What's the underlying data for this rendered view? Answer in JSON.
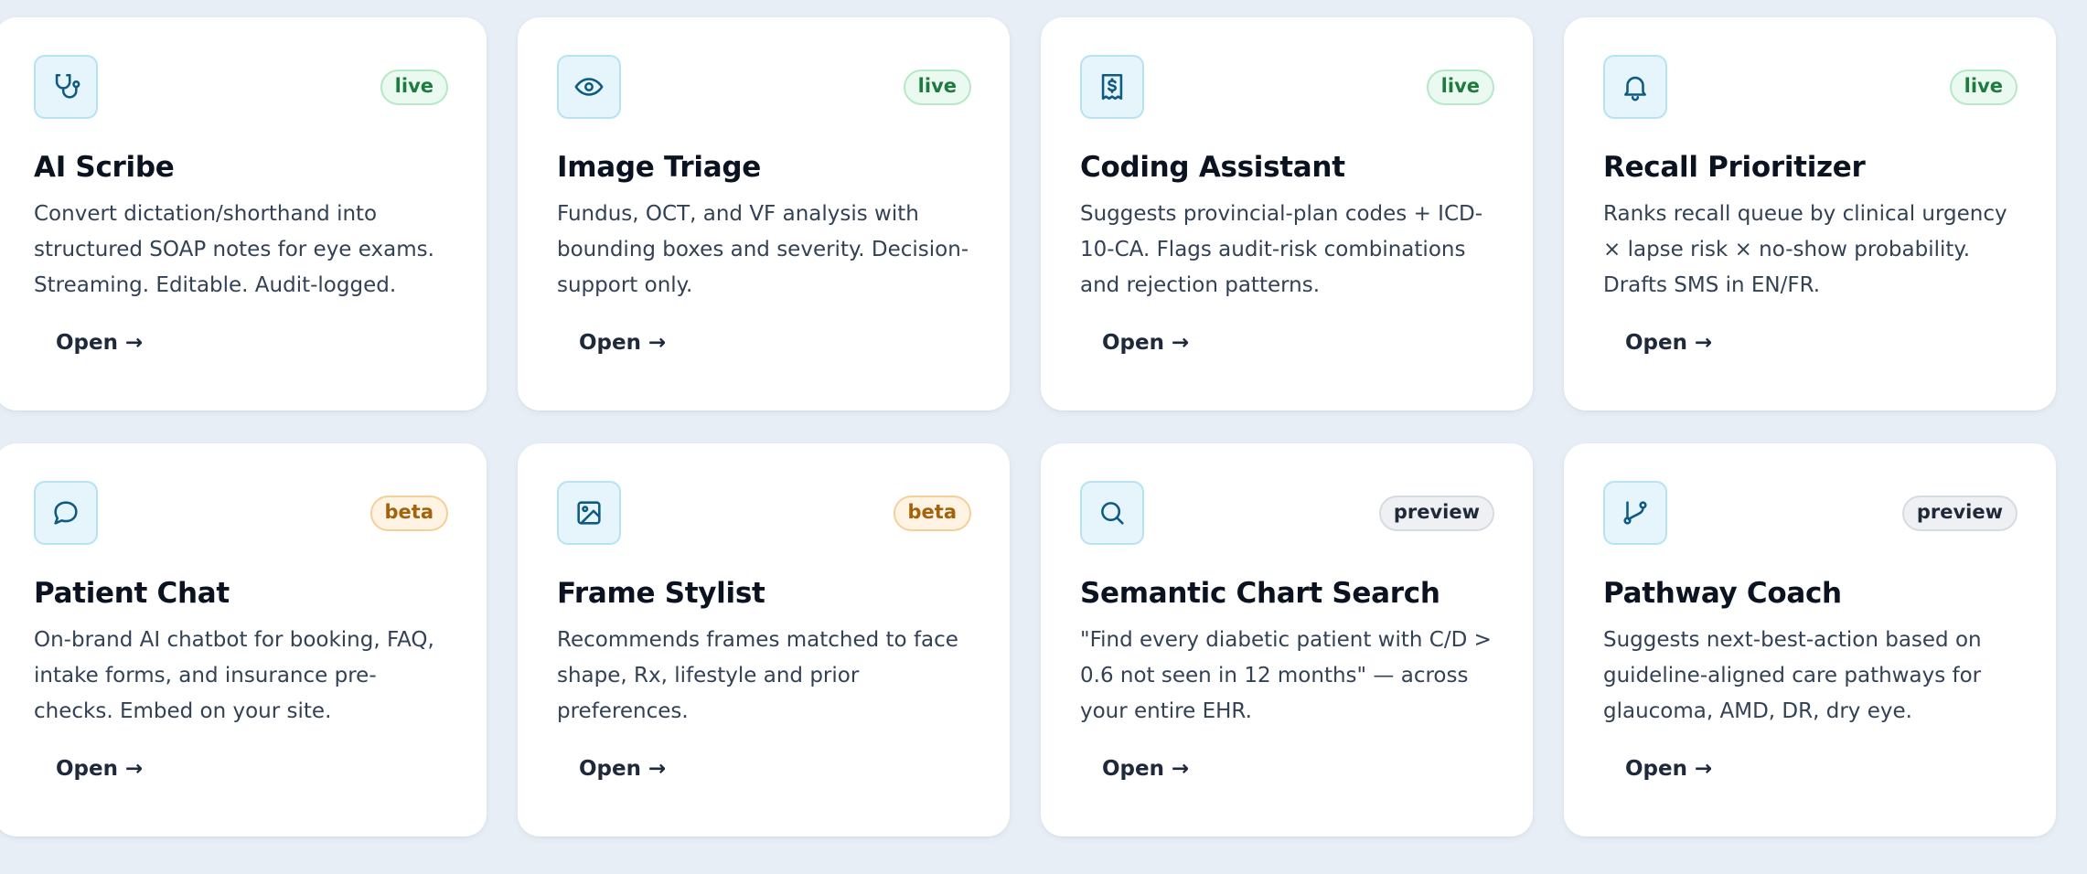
{
  "cards": [
    {
      "title": "AI Scribe",
      "badge": "live",
      "icon": "stethoscope-icon",
      "description": "Convert dictation/shorthand into structured SOAP notes for eye exams. Streaming. Editable. Audit-logged.",
      "link": "Open",
      "arrow": "→"
    },
    {
      "title": "Image Triage",
      "badge": "live",
      "icon": "eye-icon",
      "description": "Fundus, OCT, and VF analysis with bounding boxes and severity. Decision-support only.",
      "link": "Open",
      "arrow": "→"
    },
    {
      "title": "Coding Assistant",
      "badge": "live",
      "icon": "receipt-dollar-icon",
      "description": "Suggests provincial-plan codes + ICD-10-CA. Flags audit-risk combinations and rejection patterns.",
      "link": "Open",
      "arrow": "→"
    },
    {
      "title": "Recall Prioritizer",
      "badge": "live",
      "icon": "bell-icon",
      "description": "Ranks recall queue by clinical urgency × lapse risk × no-show probability. Drafts SMS in EN/FR.",
      "link": "Open",
      "arrow": "→"
    },
    {
      "title": "Patient Chat",
      "badge": "beta",
      "icon": "chat-bubble-icon",
      "description": "On-brand AI chatbot for booking, FAQ, intake forms, and insurance pre-checks. Embed on your site.",
      "link": "Open",
      "arrow": "→"
    },
    {
      "title": "Frame Stylist",
      "badge": "beta",
      "icon": "image-icon",
      "description": "Recommends frames matched to face shape, Rx, lifestyle and prior preferences.",
      "link": "Open",
      "arrow": "→"
    },
    {
      "title": "Semantic Chart Search",
      "badge": "preview",
      "icon": "search-icon",
      "description": "\"Find every diabetic patient with C/D > 0.6 not seen in 12 months\" — across your entire EHR.",
      "link": "Open",
      "arrow": "→"
    },
    {
      "title": "Pathway Coach",
      "badge": "preview",
      "icon": "git-branch-icon",
      "description": "Suggests next-best-action based on guideline-aligned care pathways for glaucoma, AMD, DR, dry eye.",
      "link": "Open",
      "arrow": "→"
    }
  ],
  "colors": {
    "icon_stroke": "#0e5a82",
    "icon_bg": "#e6f5fc",
    "live": "#1f7a3e",
    "beta": "#a3620c",
    "preview": "#1f2937",
    "page_bg": "#e8eef5"
  }
}
